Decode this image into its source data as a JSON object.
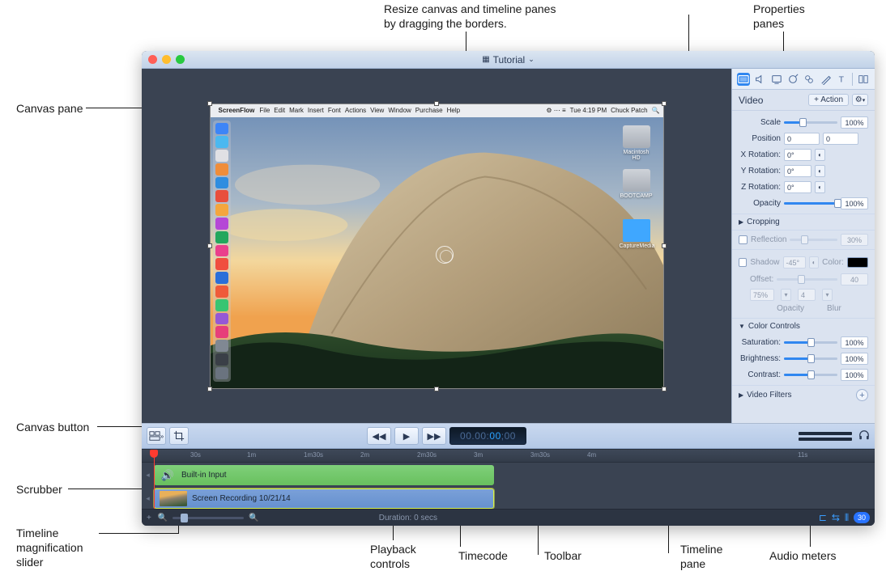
{
  "callouts": {
    "resize": "Resize canvas and timeline panes\nby dragging the borders.",
    "props_panes": "Properties\npanes",
    "canvas_pane": "Canvas pane",
    "canvas_button": "Canvas button",
    "scrubber": "Scrubber",
    "mag_slider": "Timeline\nmagnification\nslider",
    "playback": "Playback\ncontrols",
    "timecode": "Timecode",
    "toolbar": "Toolbar",
    "timeline_pane": "Timeline\npane",
    "audio_meters": "Audio meters"
  },
  "titlebar": {
    "title": "Tutorial"
  },
  "canvas": {
    "menubar_app": "ScreenFlow",
    "menus": [
      "File",
      "Edit",
      "Mark",
      "Insert",
      "Font",
      "Actions",
      "View",
      "Window",
      "Purchase",
      "Help"
    ],
    "status_time": "Tue 4:19 PM",
    "status_user": "Chuck Patch",
    "desktop_icons": [
      {
        "label": "Macintosh HD"
      },
      {
        "label": "BOOTCAMP"
      },
      {
        "label": "CaptureMedia"
      }
    ],
    "dock_colors": [
      "#3d85f7",
      "#4bb8f0",
      "#e0e0e4",
      "#ef8d3a",
      "#2f8de0",
      "#e84f3d",
      "#f4a63d",
      "#b547d6",
      "#22a75d",
      "#ea3f8c",
      "#f04e3f",
      "#2a6fd9",
      "#ef5b3a",
      "#38c572",
      "#9558d6",
      "#e73e7a",
      "#808893",
      "#3a3f47",
      "#6a737f"
    ]
  },
  "props": {
    "tabs_count": 9,
    "title": "Video",
    "add_action": "+ Action",
    "scale": {
      "label": "Scale",
      "value": "100%",
      "pct": 100
    },
    "position": {
      "label": "Position",
      "x": "0",
      "y": "0"
    },
    "xrot": {
      "label": "X Rotation:",
      "value": "0°"
    },
    "yrot": {
      "label": "Y Rotation:",
      "value": "0°"
    },
    "zrot": {
      "label": "Z Rotation:",
      "value": "0°"
    },
    "opacity": {
      "label": "Opacity",
      "value": "100%",
      "pct": 100
    },
    "cropping": "Cropping",
    "reflection": {
      "label": "Reflection",
      "value": "30%"
    },
    "shadow": {
      "label": "Shadow",
      "angle": "-45°",
      "color_label": "Color:",
      "offset_label": "Offset:",
      "offset": "40",
      "opacity_label": "Opacity",
      "opacity_val": "75%",
      "blur_label": "Blur",
      "blur_val": "4"
    },
    "color_controls": "Color Controls",
    "saturation": {
      "label": "Saturation:",
      "value": "100%",
      "pct": 50
    },
    "brightness": {
      "label": "Brightness:",
      "value": "100%",
      "pct": 50
    },
    "contrast": {
      "label": "Contrast:",
      "value": "100%",
      "pct": 50
    },
    "video_filters": "Video Filters"
  },
  "toolbar": {
    "timecode": {
      "gray": "00.00:",
      "blue": "00",
      "gray2": ";00"
    }
  },
  "timeline": {
    "ruler": [
      "30s",
      "1m",
      "1m30s",
      "2m",
      "2m30s",
      "3m",
      "3m30s",
      "4m",
      "11s"
    ],
    "audio_clip": "Built-in Input",
    "video_clip": "Screen Recording 10/21/14"
  },
  "footer": {
    "duration": "Duration: 0 secs",
    "badge": "30"
  }
}
